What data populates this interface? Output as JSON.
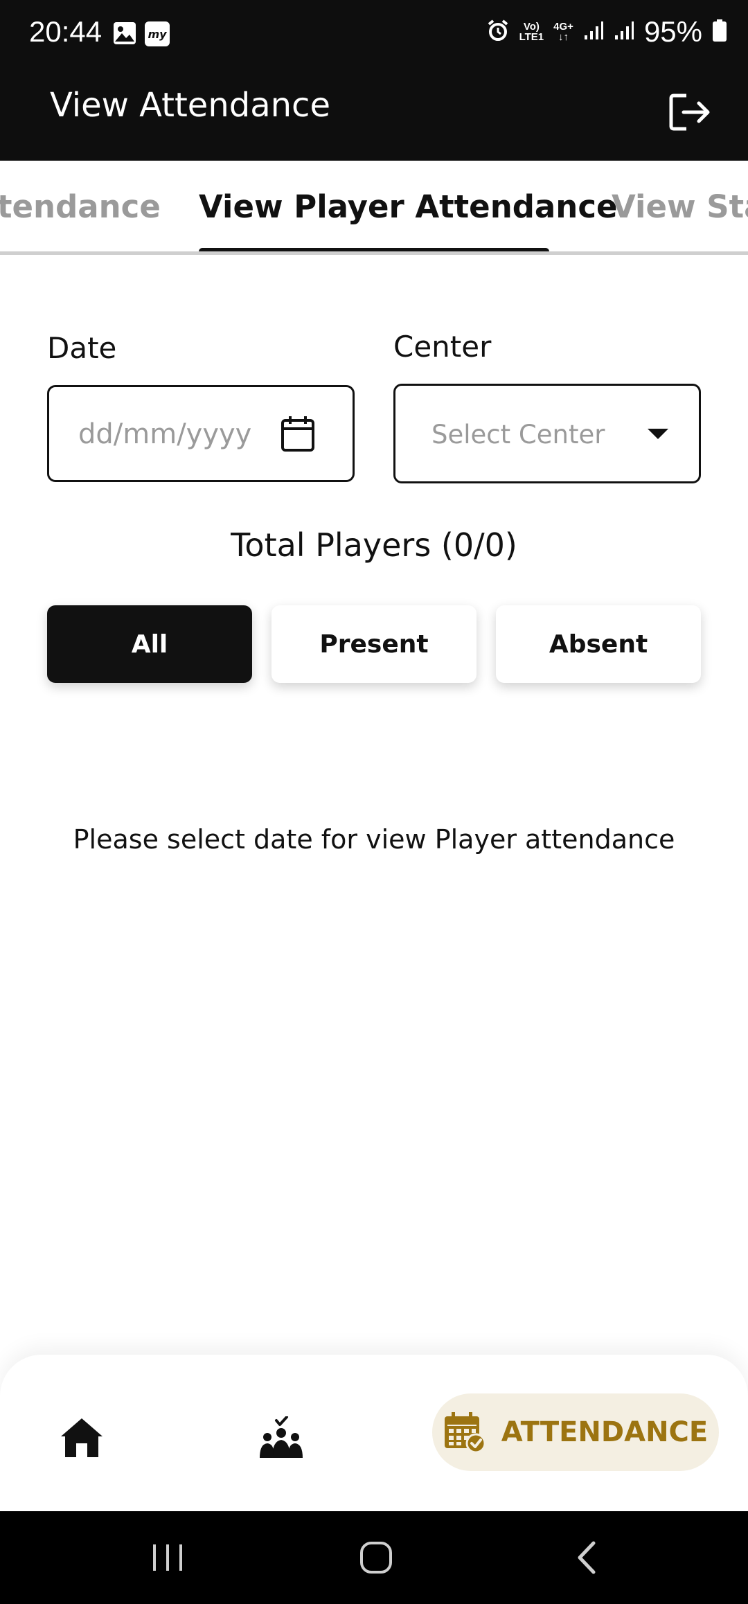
{
  "status_bar": {
    "time": "20:44",
    "battery": "95%",
    "network_top": "Vo)",
    "network_bottom": "LTE1",
    "network_type": "4G+",
    "icons": [
      "image-icon",
      "my-app-icon",
      "alarm-icon",
      "signal-icon",
      "signal-icon",
      "battery-icon"
    ]
  },
  "app_bar": {
    "title": "View Attendance",
    "logout_icon": "logout-icon"
  },
  "tabs": [
    {
      "label": "tendance",
      "active": false
    },
    {
      "label": "View Player Attendance",
      "active": true
    },
    {
      "label": "View Staf",
      "active": false
    }
  ],
  "form": {
    "date_label": "Date",
    "date_placeholder": "dd/mm/yyyy",
    "center_label": "Center",
    "center_placeholder": "Select Center"
  },
  "summary": {
    "total_players": "Total Players (0/0)"
  },
  "filters": [
    {
      "label": "All",
      "active": true
    },
    {
      "label": "Present",
      "active": false
    },
    {
      "label": "Absent",
      "active": false
    }
  ],
  "empty_message": "Please select date for view Player attendance",
  "bottom_nav": {
    "items": [
      {
        "icon": "home-icon",
        "label": ""
      },
      {
        "icon": "team-check-icon",
        "label": ""
      },
      {
        "icon": "calendar-check-icon",
        "label": "ATTENDANCE",
        "active": true
      }
    ],
    "accent_color": "#9c7411",
    "active_bg": "#f4efe2"
  },
  "system_nav": {
    "items": [
      "recent-apps-icon",
      "home-circle-icon",
      "back-icon"
    ]
  },
  "colors": {
    "header_bg": "#0e0e0e",
    "primary": "#111111",
    "muted": "#9a9a9a"
  }
}
